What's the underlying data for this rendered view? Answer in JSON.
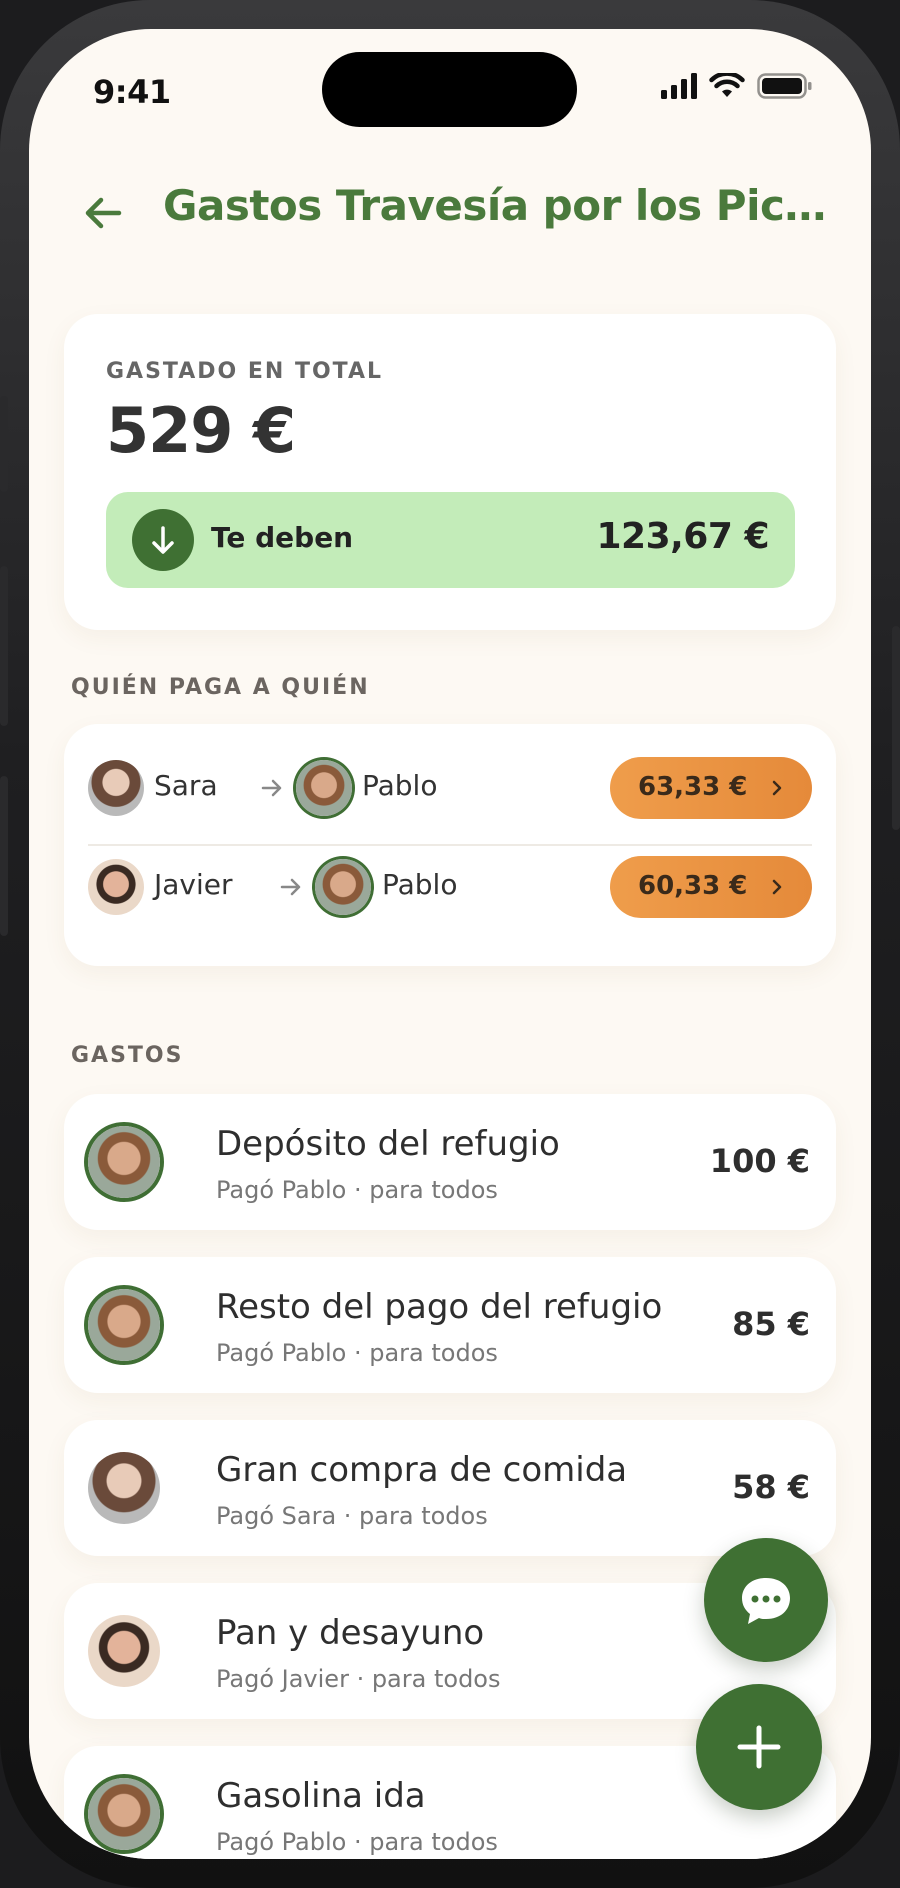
{
  "status_bar": {
    "time": "9:41"
  },
  "header": {
    "title": "Gastos Travesía por los Pico..."
  },
  "summary": {
    "label": "GASTADO EN TOTAL",
    "total": "529 €",
    "owed_label": "Te deben",
    "owed_amount": "123,67 €"
  },
  "settlements": {
    "section_label": "QUIÉN PAGA A QUIÉN",
    "rows": [
      {
        "from": "Sara",
        "to": "Pablo",
        "amount": "63,33 €"
      },
      {
        "from": "Javier",
        "to": "Pablo",
        "amount": "60,33 €"
      }
    ]
  },
  "expenses": {
    "section_label": "GASTOS",
    "items": [
      {
        "title": "Depósito del refugio",
        "subtitle": "Pagó Pablo · para todos",
        "amount": "100 €"
      },
      {
        "title": "Resto del pago del refugio",
        "subtitle": "Pagó Pablo · para todos",
        "amount": "85 €"
      },
      {
        "title": "Gran compra de comida",
        "subtitle": "Pagó Sara · para todos",
        "amount": "58 €"
      },
      {
        "title": "Pan y desayuno",
        "subtitle": "Pagó Javier · para todos",
        "amount": ""
      },
      {
        "title": "Gasolina ida",
        "subtitle": "Pagó Pablo · para todos",
        "amount": ""
      }
    ]
  },
  "colors": {
    "brand_green": "#3f7033",
    "title_green": "#4a7a3c",
    "owed_bg": "#c3ecb9",
    "pill_orange": "#e98f3e",
    "background": "#fdf9f3"
  },
  "icons": [
    "back-arrow-icon",
    "cellular-signal-icon",
    "wifi-icon",
    "battery-icon",
    "arrow-down-icon",
    "arrow-right-icon",
    "chevron-right-icon",
    "chat-bubble-icon",
    "plus-icon"
  ]
}
